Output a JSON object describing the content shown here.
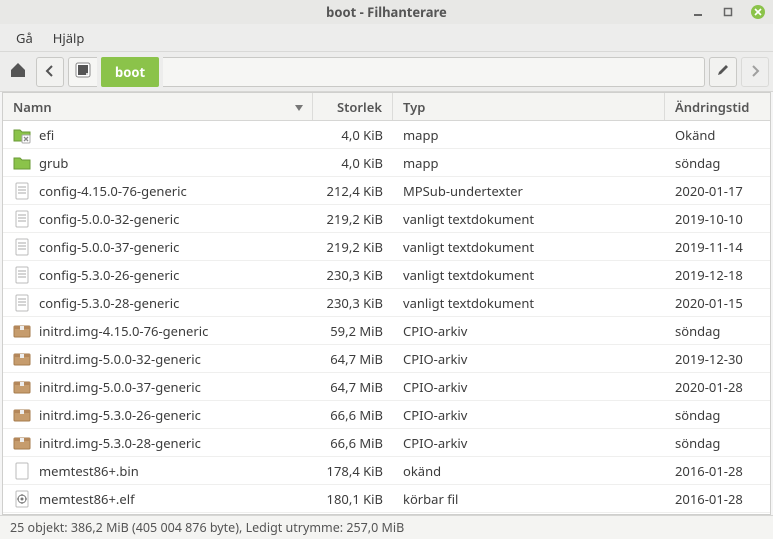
{
  "window": {
    "title": "boot - Filhanterare"
  },
  "menu": {
    "go": "Gå",
    "help": "Hjälp"
  },
  "path": {
    "crumb": "boot"
  },
  "columns": {
    "name": "Namn",
    "size": "Storlek",
    "type": "Typ",
    "mtime": "Ändringstid"
  },
  "files": [
    {
      "icon": "folder-x",
      "name": "efi",
      "size": "4,0 KiB",
      "type": "mapp",
      "mtime": "Okänd"
    },
    {
      "icon": "folder",
      "name": "grub",
      "size": "4,0 KiB",
      "type": "mapp",
      "mtime": "söndag"
    },
    {
      "icon": "text",
      "name": "config-4.15.0-76-generic",
      "size": "212,4 KiB",
      "type": "MPSub-undertexter",
      "mtime": "2020-01-17"
    },
    {
      "icon": "text",
      "name": "config-5.0.0-32-generic",
      "size": "219,2 KiB",
      "type": "vanligt textdokument",
      "mtime": "2019-10-10"
    },
    {
      "icon": "text",
      "name": "config-5.0.0-37-generic",
      "size": "219,2 KiB",
      "type": "vanligt textdokument",
      "mtime": "2019-11-14"
    },
    {
      "icon": "text",
      "name": "config-5.3.0-26-generic",
      "size": "230,3 KiB",
      "type": "vanligt textdokument",
      "mtime": "2019-12-18"
    },
    {
      "icon": "text",
      "name": "config-5.3.0-28-generic",
      "size": "230,3 KiB",
      "type": "vanligt textdokument",
      "mtime": "2020-01-15"
    },
    {
      "icon": "archive",
      "name": "initrd.img-4.15.0-76-generic",
      "size": "59,2 MiB",
      "type": "CPIO-arkiv",
      "mtime": "söndag"
    },
    {
      "icon": "archive",
      "name": "initrd.img-5.0.0-32-generic",
      "size": "64,7 MiB",
      "type": "CPIO-arkiv",
      "mtime": "2019-12-30"
    },
    {
      "icon": "archive",
      "name": "initrd.img-5.0.0-37-generic",
      "size": "64,7 MiB",
      "type": "CPIO-arkiv",
      "mtime": "2020-01-28"
    },
    {
      "icon": "archive",
      "name": "initrd.img-5.3.0-26-generic",
      "size": "66,6 MiB",
      "type": "CPIO-arkiv",
      "mtime": "söndag"
    },
    {
      "icon": "archive",
      "name": "initrd.img-5.3.0-28-generic",
      "size": "66,6 MiB",
      "type": "CPIO-arkiv",
      "mtime": "söndag"
    },
    {
      "icon": "unknown",
      "name": "memtest86+.bin",
      "size": "178,4 KiB",
      "type": "okänd",
      "mtime": "2016-01-28"
    },
    {
      "icon": "exec",
      "name": "memtest86+.elf",
      "size": "180,1 KiB",
      "type": "körbar fil",
      "mtime": "2016-01-28"
    }
  ],
  "status": "25 objekt: 386,2 MiB (405 004 876 byte), Ledigt utrymme: 257,0 MiB"
}
